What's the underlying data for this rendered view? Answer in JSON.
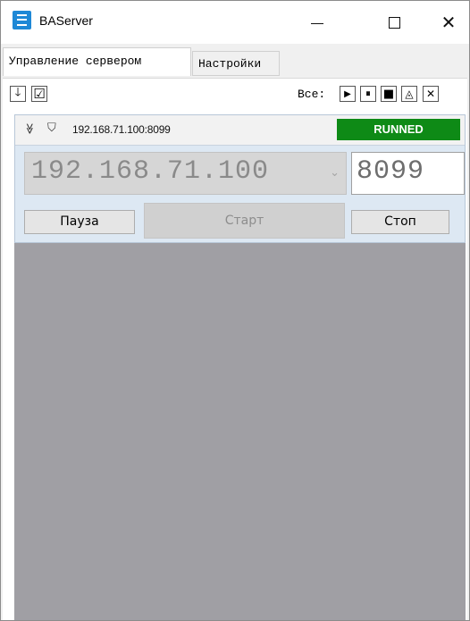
{
  "window": {
    "title": "BAServer",
    "controls": {
      "minimize": "—",
      "maximize": "☐",
      "close": "✕"
    }
  },
  "tabs": [
    {
      "label": "Управление сервером",
      "active": true
    },
    {
      "label": "Настройки",
      "active": false
    }
  ],
  "toolbar": {
    "collapse_icon": "arrow-down-icon",
    "collapse_glyph": "🡓",
    "check_icon": "checkbox-checked-icon",
    "check_glyph": "☑",
    "all_label": "Все:",
    "actions": [
      {
        "name": "play-all",
        "glyph": "▶"
      },
      {
        "name": "pause-all",
        "glyph": "⏸"
      },
      {
        "name": "stop-all",
        "glyph": "■"
      },
      {
        "name": "minimize-all",
        "glyph": "◬"
      },
      {
        "name": "close-all",
        "glyph": "✕"
      }
    ]
  },
  "server": {
    "name": "192.168.71.100:8099",
    "status": "RUNNED",
    "status_color": "#0e8a16",
    "ip": "192.168.71.100",
    "port": "8099",
    "buttons": {
      "pause": "Пауза",
      "start": "Старт",
      "stop": "Стоп"
    },
    "chevron_glyph": "≫",
    "shield_glyph": "⛉"
  }
}
